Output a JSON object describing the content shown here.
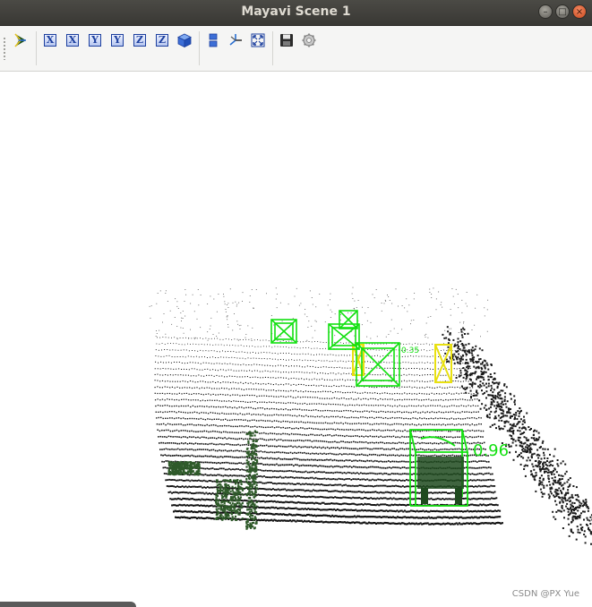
{
  "window": {
    "title": "Mayavi Scene 1"
  },
  "window_controls": {
    "minimize": "–",
    "maximize": "□",
    "close": "×"
  },
  "toolbar": {
    "buttons": [
      {
        "name": "mayavi-pipeline",
        "icon": "mayavi-logo-icon"
      },
      {
        "name": "view-plus-x",
        "label": "X",
        "icon": "axis-x-icon"
      },
      {
        "name": "view-minus-x",
        "label": "X",
        "icon": "axis-x-icon"
      },
      {
        "name": "view-plus-y",
        "label": "Y",
        "icon": "axis-y-icon"
      },
      {
        "name": "view-minus-y",
        "label": "Y",
        "icon": "axis-y-icon"
      },
      {
        "name": "view-plus-z",
        "label": "Z",
        "icon": "axis-z-icon"
      },
      {
        "name": "view-minus-z",
        "label": "Z",
        "icon": "axis-z-icon"
      },
      {
        "name": "isometric-view",
        "icon": "cube-icon"
      },
      {
        "name": "toggle-parallel-projection",
        "icon": "parallel-projection-icon"
      },
      {
        "name": "toggle-axes-indicator",
        "icon": "axes-indicator-icon"
      },
      {
        "name": "full-screen",
        "icon": "fullscreen-icon"
      },
      {
        "name": "save-snapshot",
        "icon": "save-icon"
      },
      {
        "name": "scene-configure",
        "icon": "gear-icon"
      }
    ]
  },
  "scene": {
    "background": "#ffffff",
    "detections": [
      {
        "score": "0.96",
        "color": "#12e010"
      },
      {
        "score": "0.35",
        "color": "#12e010"
      }
    ],
    "colors": {
      "points": "#111111",
      "highlight_points": "#2f5a2a",
      "box_green": "#12e010",
      "box_yellow": "#e8e010"
    }
  },
  "watermark": "CSDN @PX Yue"
}
